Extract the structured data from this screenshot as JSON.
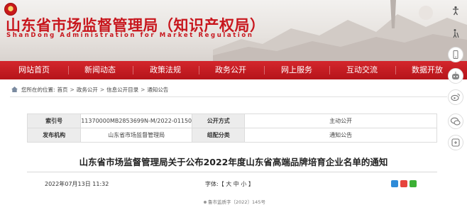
{
  "site": {
    "title": "山东省市场监督管理局（知识产权局）",
    "subtitle": "ShanDong Administration for Market Regulation"
  },
  "nav": {
    "items": [
      {
        "label": "网站首页"
      },
      {
        "label": "新闻动态"
      },
      {
        "label": "政策法规"
      },
      {
        "label": "政务公开"
      },
      {
        "label": "网上服务"
      },
      {
        "label": "互动交流"
      },
      {
        "label": "数据开放"
      }
    ]
  },
  "breadcrumb": {
    "prefix": "您所在的位置:",
    "items": [
      "首页",
      "政务公开",
      "信息公开目录",
      "通知公告"
    ],
    "separator": ">"
  },
  "info_table": {
    "rows": [
      {
        "k1": "索引号",
        "v1": "11370000MB2853699N-M/2022-01150",
        "k2": "公开方式",
        "v2": "主动公开"
      },
      {
        "k1": "发布机构",
        "v1": "山东省市场监督管理局",
        "k2": "组配分类",
        "v2": "通知公告"
      }
    ]
  },
  "article": {
    "title": "山东省市场监督管理局关于公布2022年度山东省高端品牌培育企业名单的通知",
    "date": "2022年07月13日 11:32",
    "font_size_label": "字体:【 大 中 小 】",
    "doc_number": "鲁市监质字〔2022〕145号"
  },
  "share": {
    "icons": [
      "qzone-icon",
      "weibo-icon",
      "wechat-icon"
    ],
    "colors": [
      "#2e8bd8",
      "#e6443d",
      "#3cb035"
    ]
  },
  "colors": {
    "brand_red": "#c8161d",
    "nav_red": "#c41d23"
  }
}
